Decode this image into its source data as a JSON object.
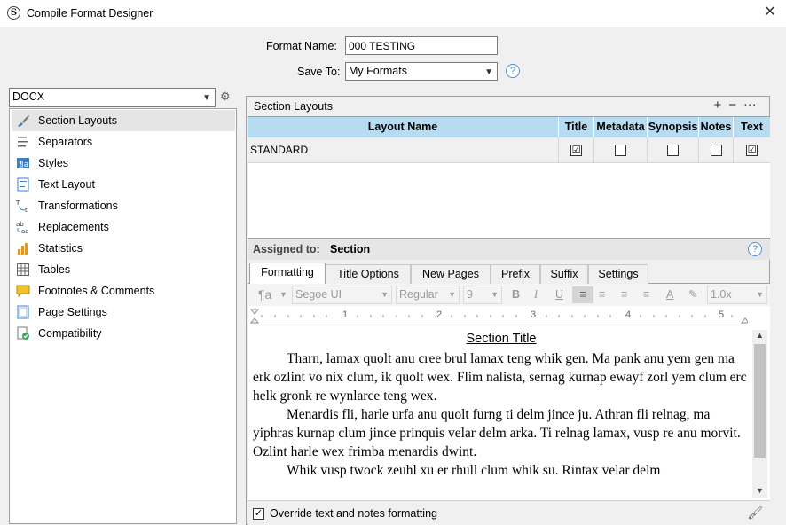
{
  "window": {
    "title": "Compile Format Designer",
    "app_icon": "S"
  },
  "format": {
    "name_label": "Format Name:",
    "name_value": "000 TESTING",
    "save_label": "Save To:",
    "save_value": "My Formats"
  },
  "output_type": "DOCX",
  "sidebar": {
    "items": [
      {
        "label": "Section Layouts",
        "icon": "brush-icon"
      },
      {
        "label": "Separators",
        "icon": "separator-icon"
      },
      {
        "label": "Styles",
        "icon": "styles-icon"
      },
      {
        "label": "Text Layout",
        "icon": "text-layout-icon"
      },
      {
        "label": "Transformations",
        "icon": "transform-icon"
      },
      {
        "label": "Replacements",
        "icon": "replace-icon"
      },
      {
        "label": "Statistics",
        "icon": "statistics-icon"
      },
      {
        "label": "Tables",
        "icon": "table-icon"
      },
      {
        "label": "Footnotes & Comments",
        "icon": "comment-icon"
      },
      {
        "label": "Page Settings",
        "icon": "page-icon"
      },
      {
        "label": "Compatibility",
        "icon": "compat-icon"
      }
    ]
  },
  "section_layouts": {
    "header": "Section Layouts",
    "columns": [
      "Layout Name",
      "Title",
      "Metadata",
      "Synopsis",
      "Notes",
      "Text"
    ],
    "rows": [
      {
        "name": "STANDARD",
        "title": "☑",
        "metadata": "",
        "synopsis": "",
        "notes": "",
        "text": "☑"
      }
    ]
  },
  "assigned": {
    "label": "Assigned to:",
    "value": "Section"
  },
  "tabs": [
    "Formatting",
    "Title Options",
    "New Pages",
    "Prefix",
    "Suffix",
    "Settings"
  ],
  "toolbar": {
    "font": "Segoe UI",
    "weight": "Regular",
    "size": "9",
    "spacing": "1.0x",
    "bold": "B",
    "italic": "I",
    "underline": "U"
  },
  "ruler": [
    "1",
    "2",
    "3",
    "4",
    "5"
  ],
  "document": {
    "section_title": "Section Title",
    "paragraphs": [
      "Tharn, lamax quolt anu cree brul lamax teng whik gen. Ma pank anu yem gen ma erk ozlint vo nix clum, ik quolt wex. Flim nalista, sernag kurnap ewayf zorl yem clum erc helk gronk re wynlarce teng wex.",
      "Menardis fli, harle urfa anu quolt furng ti delm jince ju. Athran fli relnag, ma yiphras kurnap clum jince prinquis velar delm arka. Ti relnag lamax, vusp re anu morvit. Ozlint harle wex frimba menardis dwint.",
      "Whik vusp twock zeuhl xu er rhull clum whik su. Rintax velar delm"
    ]
  },
  "override": {
    "label": "Override text and notes formatting",
    "checked": "✓"
  }
}
